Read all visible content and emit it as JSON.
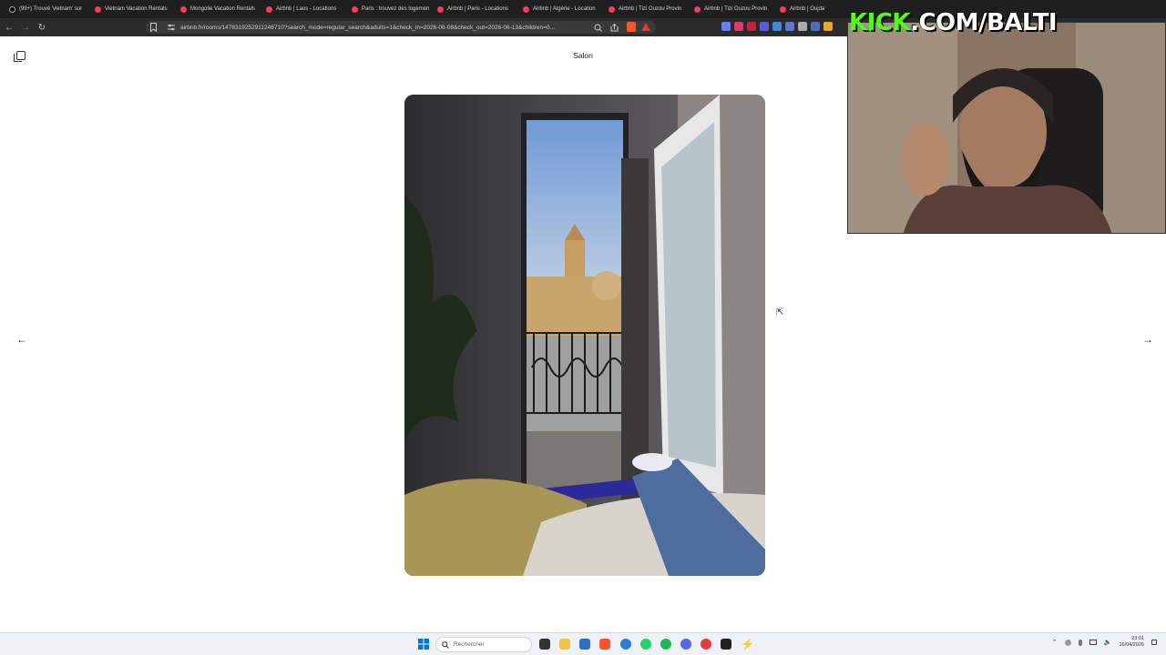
{
  "browser": {
    "tabs": [
      "(99+) Trouvé 'vietnam' sur",
      "Vietnam Vacation Rentals",
      "Mongolie Vacation Rentals",
      "Airbnb | Laos - Locations",
      "Paris : trouvez des logemen",
      "Airbnb | Paris - Locations",
      "Airbnb | Algérie - Location",
      "Airbnb | Tizi Ouzou Provin",
      "Airbnb | Tizi Ouzou Provin",
      "Airbnb | Oujda"
    ],
    "url": "airbnb.fr/rooms/1478319252911246710?search_mode=regular_search&adults=1&check_in=2026-06-08&check_out=2026-06-13&children=0..."
  },
  "gallery": {
    "title": "Salon"
  },
  "overlay": {
    "kick_green": "KICK",
    "kick_white": ".COM/BALTI"
  },
  "taskbar": {
    "search_placeholder": "Rechercher",
    "time": "23:01",
    "date": "16/04/2026"
  },
  "colors": {
    "airbnb": "#ff385c",
    "kick_green": "#53fc18"
  }
}
